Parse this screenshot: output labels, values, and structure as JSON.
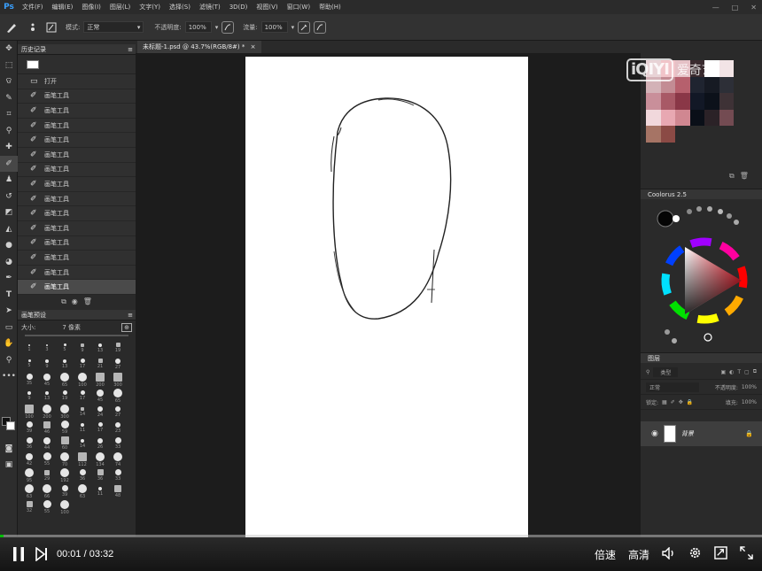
{
  "menubar": {
    "app_logo": "Ps",
    "items": [
      "文件(F)",
      "编辑(E)",
      "图像(I)",
      "图层(L)",
      "文字(Y)",
      "选择(S)",
      "滤镜(T)",
      "3D(D)",
      "视图(V)",
      "窗口(W)",
      "帮助(H)"
    ],
    "window_controls": [
      "—",
      "□",
      "✕"
    ]
  },
  "options_bar": {
    "mode_label": "模式:",
    "mode_value": "正常",
    "opacity_label": "不透明度:",
    "opacity_value": "100%",
    "flow_label": "流量:",
    "flow_value": "100%"
  },
  "document": {
    "tab_title": "未标题-1.psd @ 43.7%(RGB/8#) *",
    "close_glyph": "×"
  },
  "history": {
    "panel_title": "历史记录",
    "open_label": "打开",
    "items": [
      "画笔工具",
      "画笔工具",
      "画笔工具",
      "画笔工具",
      "画笔工具",
      "画笔工具",
      "画笔工具",
      "画笔工具",
      "画笔工具",
      "画笔工具",
      "画笔工具",
      "画笔工具",
      "画笔工具",
      "画笔工具"
    ]
  },
  "brush_presets": {
    "panel_title": "画笔预设",
    "size_label": "大小:",
    "size_value": "7 像素",
    "sizes": [
      "1",
      "3",
      "5",
      "9",
      "13",
      "19",
      "5",
      "9",
      "13",
      "17",
      "21",
      "27",
      "35",
      "45",
      "65",
      "100",
      "200",
      "300",
      "9",
      "13",
      "19",
      "17",
      "45",
      "65",
      "100",
      "200",
      "300",
      "14",
      "24",
      "27",
      "39",
      "46",
      "59",
      "11",
      "17",
      "23",
      "36",
      "44",
      "60",
      "14",
      "26",
      "33",
      "42",
      "55",
      "70",
      "112",
      "134",
      "74",
      "95",
      "29",
      "192",
      "36",
      "36",
      "33",
      "63",
      "66",
      "39",
      "63",
      "11",
      "48",
      "32",
      "55",
      "100"
    ]
  },
  "swatches": {
    "colors": [
      [
        "#e8d3d6",
        "#f1c4c9",
        "#e5c1c6",
        "#3a2b2f",
        "#ffffff",
        "#f2e4e6"
      ],
      [
        "#d3b2b7",
        "#c38c94",
        "#b6606d",
        "#1f2430",
        "#161a23",
        "#2d2f37"
      ],
      [
        "#c98f9a",
        "#a85966",
        "#8a3747",
        "#121826",
        "#0c111a",
        "#3e3236"
      ],
      [
        "#f1d8dc",
        "#e8a8b2",
        "#d08791",
        "#0a0f18",
        "#2b2227",
        "#734b52"
      ],
      [
        "#a67465",
        "#8b4a45"
      ]
    ]
  },
  "coolorus": {
    "panel_title": "Coolorus 2.5"
  },
  "layers": {
    "panel_title": "图层",
    "filter_label": "类型",
    "blend_value": "正常",
    "opacity_label": "不透明度:",
    "opacity_value": "100%",
    "lock_label": "锁定:",
    "fill_label": "填充:",
    "fill_value": "100%",
    "layer_name": "背景"
  },
  "watermark": {
    "logo": "iQIYI",
    "brand": "爱奇艺"
  },
  "player": {
    "current_time": "00:01",
    "separator": "/",
    "total_time": "03:32",
    "progress": 0.005,
    "speed_label": "倍速",
    "quality_label": "高清"
  }
}
